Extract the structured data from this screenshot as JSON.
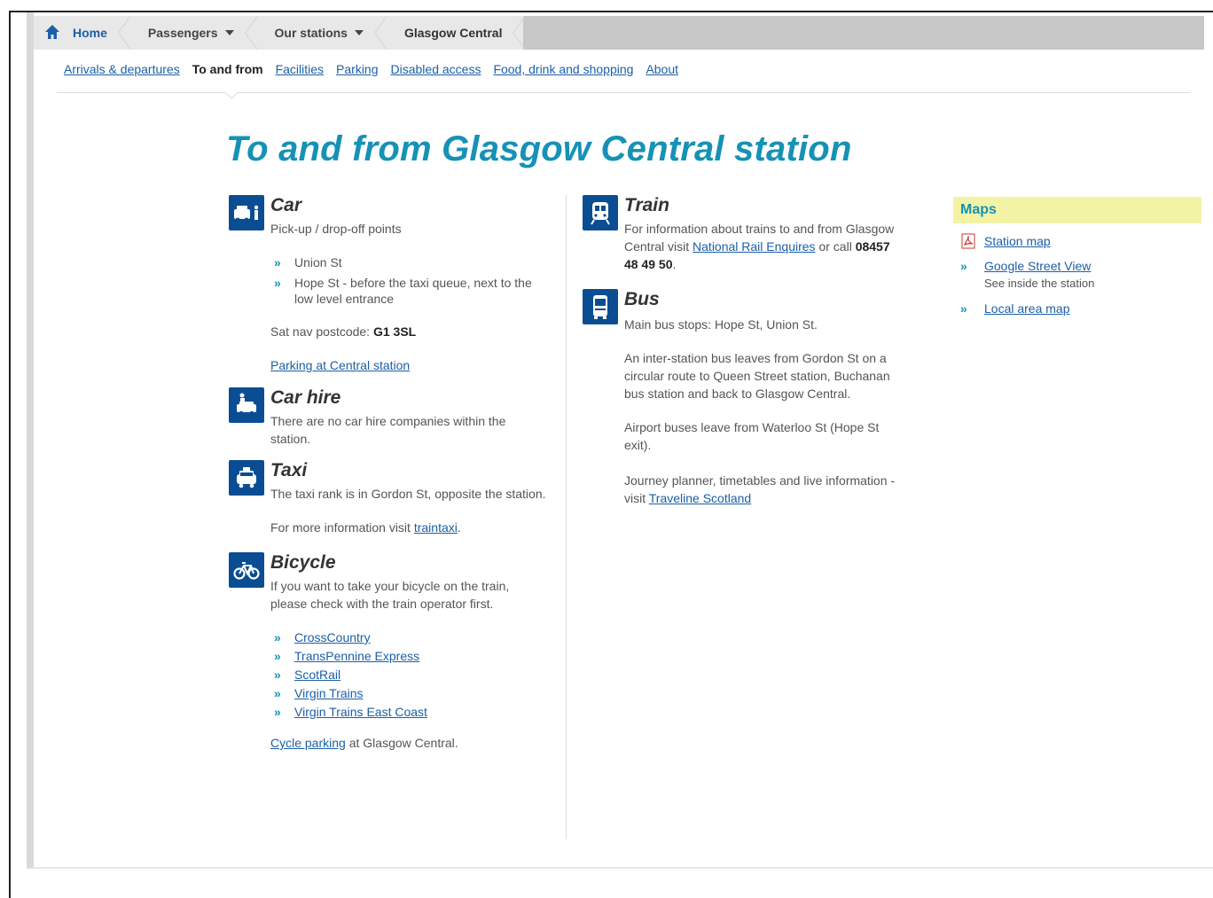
{
  "breadcrumb": {
    "home": "Home",
    "passengers": "Passengers",
    "our_stations": "Our stations",
    "current": "Glasgow Central"
  },
  "subnav": {
    "arrivals": "Arrivals & departures",
    "to_and_from": "To and from",
    "facilities": "Facilities",
    "parking": "Parking",
    "disabled": "Disabled access",
    "food": "Food, drink and shopping",
    "about": "About"
  },
  "page_title": "To and from Glasgow Central station",
  "car": {
    "title": "Car",
    "subtitle": "Pick-up / drop-off points",
    "points": [
      "Union St",
      "Hope St - before the taxi queue, next to the low level entrance"
    ],
    "postcode_label": "Sat nav postcode:",
    "postcode": "G1 3SL",
    "parking_link": "Parking at Central station"
  },
  "car_hire": {
    "title": "Car hire",
    "text": "There are no car hire companies within the station."
  },
  "taxi": {
    "title": "Taxi",
    "text": "The taxi rank is in Gordon St, opposite the station.",
    "more_prefix": "For more information visit",
    "more_link": "traintaxi",
    "more_suffix": "."
  },
  "bicycle": {
    "title": "Bicycle",
    "text": "If you want to take your bicycle on the train, please check with the train operator first.",
    "operators": [
      "CrossCountry",
      "TransPennine Express",
      "ScotRail",
      "Virgin Trains",
      "Virgin Trains East Coast"
    ],
    "cycle_link": "Cycle parking",
    "cycle_suffix": "at Glasgow Central."
  },
  "train": {
    "title": "Train",
    "text_prefix": "For information about trains to and from Glasgow Central visit",
    "link": "National Rail Enquires",
    "text_mid": "or call",
    "phone": "08457 48 49 50",
    "text_suffix": "."
  },
  "bus": {
    "title": "Bus",
    "stops": "Main bus stops: Hope St, Union St.",
    "inter_station": "An inter-station bus leaves from Gordon St on a circular route to Queen Street station, Buchanan bus station and back to Glasgow Central.",
    "airport": "Airport buses leave from Waterloo St (Hope St exit).",
    "journey_prefix": "Journey planner, timetables and live information - visit",
    "journey_link": "Traveline Scotland"
  },
  "maps": {
    "heading": "Maps",
    "station_map": "Station map",
    "street_view": "Google Street View",
    "street_view_sub": "See inside the station",
    "local_map": "Local area map"
  },
  "colors": {
    "accent": "#1592b5",
    "link": "#1b5fa8",
    "icon_bg": "#0b4d93",
    "maps_head_bg": "#f3f3a6"
  }
}
